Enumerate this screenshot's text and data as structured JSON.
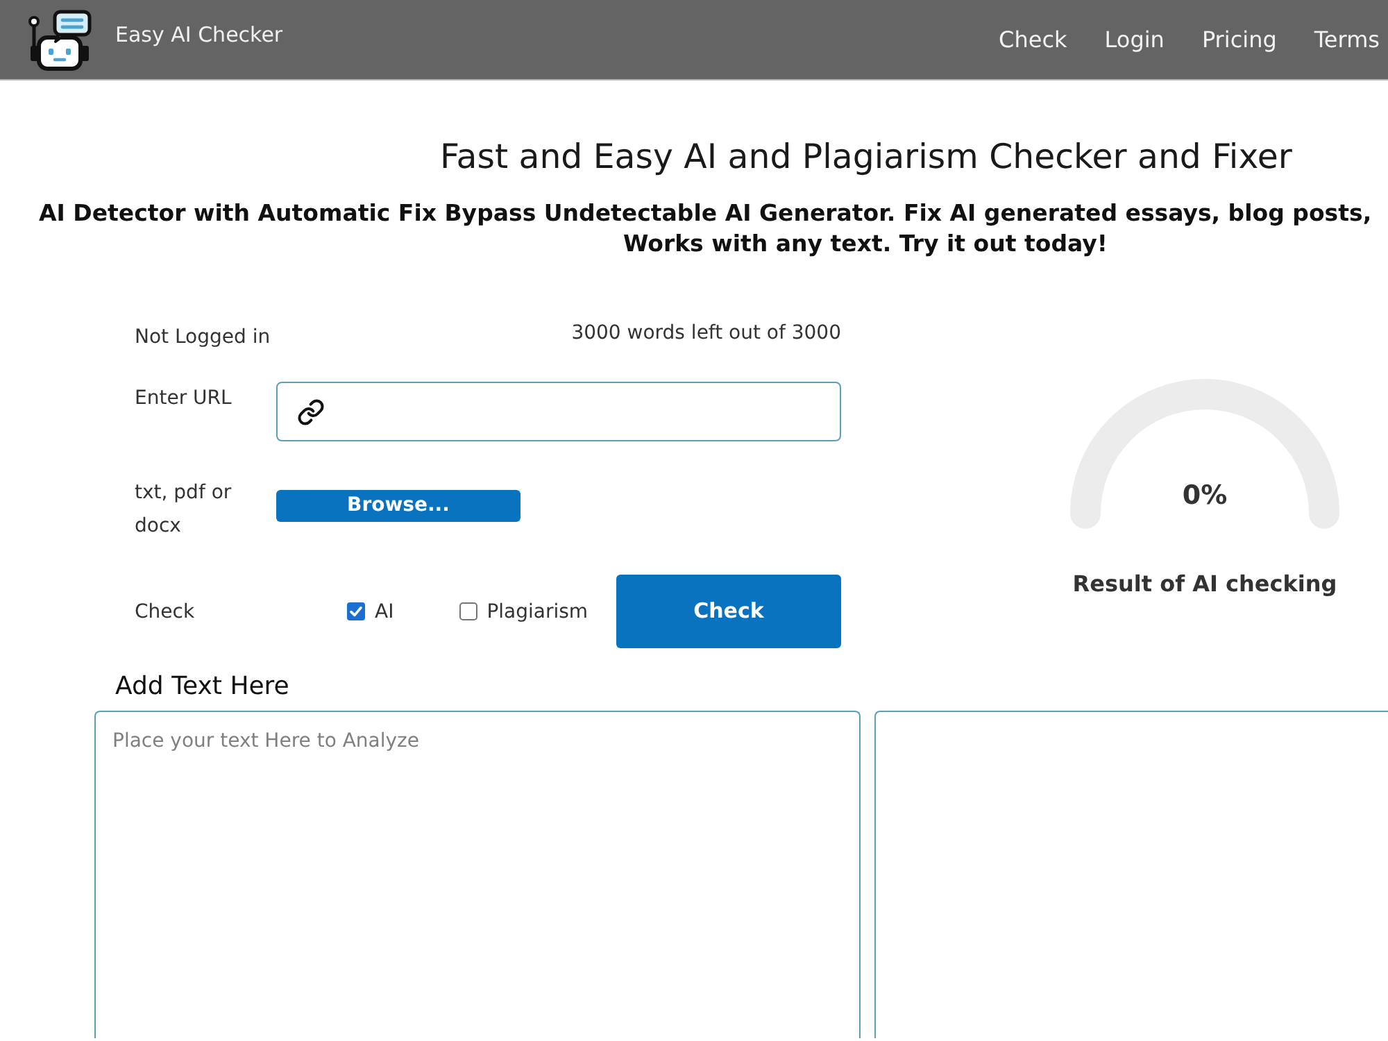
{
  "header": {
    "brand": "Easy AI Checker",
    "nav": [
      {
        "label": "Check"
      },
      {
        "label": "Login"
      },
      {
        "label": "Pricing"
      },
      {
        "label": "Terms"
      }
    ]
  },
  "hero": {
    "title": "Fast and Easy AI and Plagiarism Checker and Fixer",
    "subtitle_lines": [
      "AI Detector with Automatic Fix Bypass Undetectable AI Generator. Fix AI generated essays, blog posts,",
      "Works with any text. Try it out today!"
    ]
  },
  "form": {
    "login_status": "Not Logged in",
    "word_count": "3000 words left out of 3000",
    "url_label": "Enter URL",
    "file_label": "txt, pdf or docx",
    "browse_button": "Browse...",
    "check_label": "Check",
    "options": [
      {
        "label": "AI",
        "checked": true
      },
      {
        "label": "Plagiarism",
        "checked": false
      }
    ],
    "check_button": "Check"
  },
  "result": {
    "value": "0%",
    "caption": "Result of AI checking"
  },
  "editor": {
    "heading": "Add Text Here",
    "input_placeholder": "Place your text Here to Analyze"
  }
}
